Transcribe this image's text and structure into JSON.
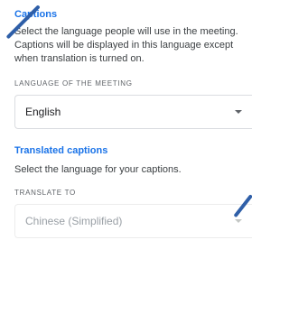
{
  "captions": {
    "heading": "Captions",
    "description": "Select the language people will use in the meeting. Captions will be displayed in this language except when translation is turned on.",
    "field_label": "LANGUAGE OF THE MEETING",
    "selected_value": "English"
  },
  "translated_captions": {
    "heading": "Translated captions",
    "description": "Select the language for your captions.",
    "field_label": "TRANSLATE TO",
    "selected_value": "Chinese (Simplified)"
  },
  "icons": {
    "dropdown": "caret-down-icon",
    "pointer": "pointer-arrow-icon"
  },
  "colors": {
    "accent": "#1a73e8",
    "text": "#3c4043",
    "disabled_text": "#9aa0a6",
    "pointer": "#2f5fa8"
  }
}
